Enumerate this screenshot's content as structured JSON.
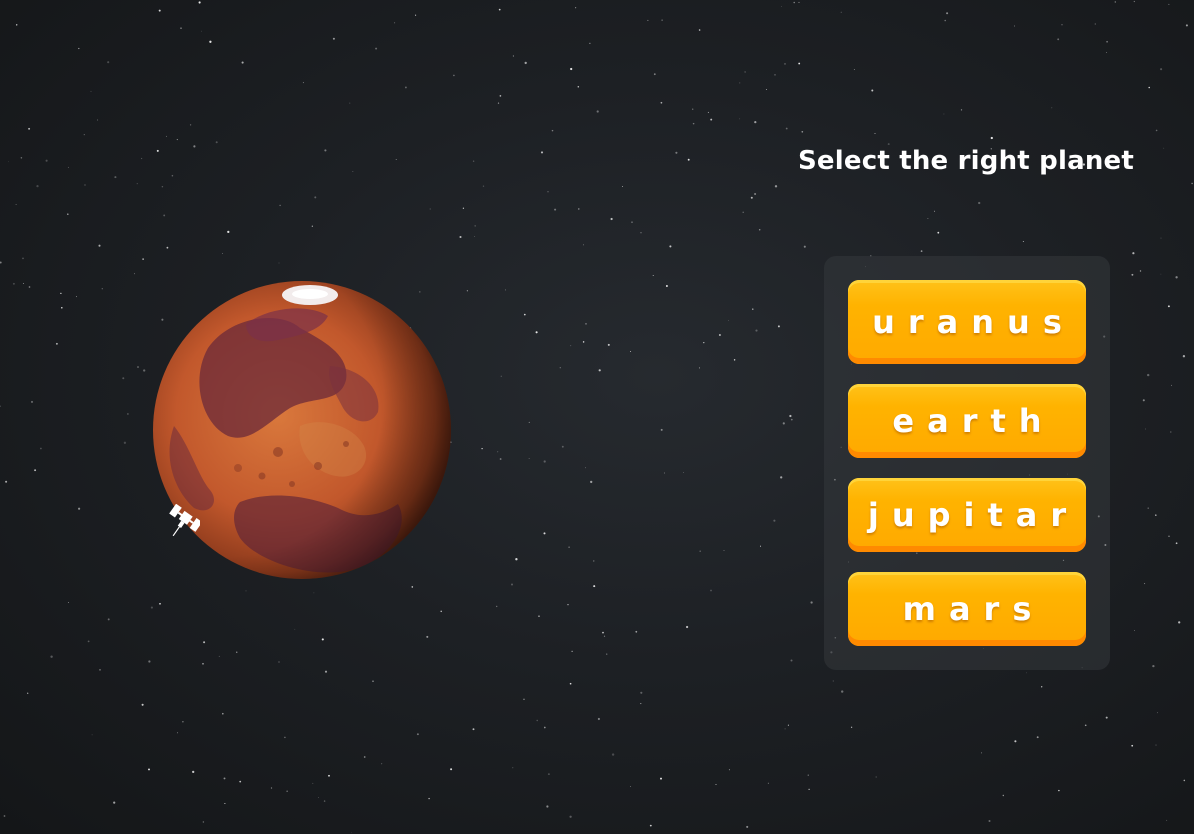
{
  "game": {
    "prompt": "Select the right planet",
    "choices": [
      {
        "label": "uranus"
      },
      {
        "label": "earth"
      },
      {
        "label": "jupitar"
      },
      {
        "label": "mars"
      }
    ]
  },
  "scene": {
    "planet_icon": "mars-planet",
    "probe_icon": "space-probe",
    "background": "starfield"
  },
  "colors": {
    "button_face": "#ffb300",
    "button_edge": "#ff8a00",
    "text": "#ffffff"
  }
}
